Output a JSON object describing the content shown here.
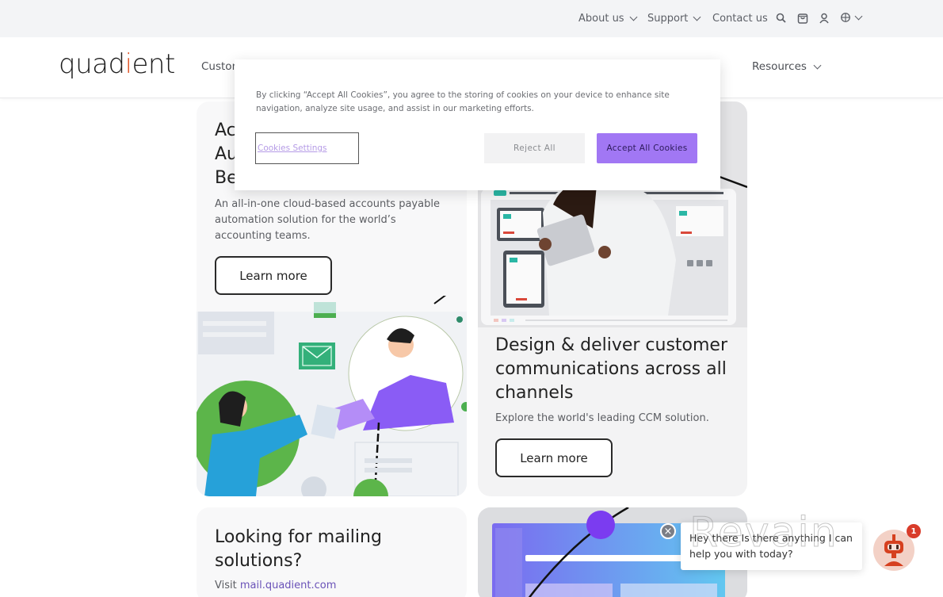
{
  "utility_nav": {
    "about": "About us",
    "support": "Support",
    "contact": "Contact us",
    "icons": [
      "search-icon",
      "cart-icon",
      "user-icon",
      "globe-icon"
    ]
  },
  "main_nav": {
    "logo_text_pre": "quad",
    "logo_text_mark": "i",
    "logo_text_post": "ent",
    "items": [
      "Custom",
      "Resources"
    ]
  },
  "cookie_banner": {
    "text": "By clicking “Accept All Cookies”, you agree to the storing of cookies on your device to enhance site navigation, analyze site usage, and assist in our marketing efforts.",
    "settings_label": "Cookies Settings",
    "reject_label": "Reject All",
    "accept_label": "Accept All Cookies"
  },
  "cards": [
    {
      "title_lines": [
        "Ac",
        "Au",
        "Be"
      ],
      "description": "An all-in-one cloud-based accounts payable automation solution for the world’s accounting teams.",
      "button": "Learn more"
    },
    {
      "title": "Design & deliver customer communications across all channels",
      "description": "Explore the world's leading CCM solution.",
      "button": "Learn more"
    },
    {
      "title": "Looking for mailing solutions?",
      "description_prefix": "Visit ",
      "link": "mail.quadient.com"
    }
  ],
  "chat": {
    "message": "Hey there Is there anything I can help you with today?",
    "badge_count": "1",
    "close_symbol": "×"
  },
  "watermark": "Revain",
  "colors": {
    "accent_purple": "#a177f4",
    "logo_orange": "#e0572a",
    "link_purple": "#6a52b8"
  }
}
